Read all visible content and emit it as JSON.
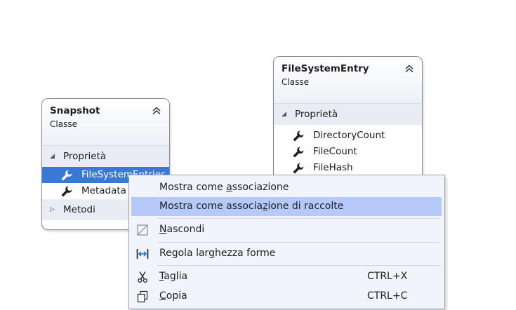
{
  "shapes": {
    "snapshot": {
      "title": "Snapshot",
      "type": "Classe",
      "properties_label": "Proprietà",
      "properties": [
        "FileSystemEntries",
        "Metadata"
      ],
      "methods_label": "Metodi"
    },
    "filesystementry": {
      "title": "FileSystemEntry",
      "type": "Classe",
      "properties_label": "Proprietà",
      "properties": [
        "DirectoryCount",
        "FileCount",
        "FileHash"
      ]
    }
  },
  "context_menu": {
    "show_as_association": {
      "before": "Mostra come ",
      "accel": "a",
      "after": "ssociazione"
    },
    "show_as_collection_association": {
      "before": "Mostra come associa",
      "accel": "z",
      "after": "ione di raccolte"
    },
    "hide": {
      "before": "",
      "accel": "N",
      "after": "ascondi"
    },
    "adjust_width": {
      "before": "Regola lar",
      "accel": "g",
      "after": "hezza forme"
    },
    "cut": {
      "before": "",
      "accel": "T",
      "after": "aglia",
      "shortcut": "CTRL+X"
    },
    "copy": {
      "before": "",
      "accel": "C",
      "after": "opia",
      "shortcut": "CTRL+C"
    }
  },
  "colors": {
    "selection": "#3a78d6",
    "menu_highlight": "#b5c9fb",
    "menu_background": "#f2f4fc",
    "section_background": "#e9ecf4",
    "icon_dark": "#1e1e1e"
  },
  "icons": [
    "collapse-chevron-icon",
    "wrench-icon",
    "hide-icon",
    "adjust-width-icon",
    "scissors-icon",
    "copy-icon"
  ]
}
